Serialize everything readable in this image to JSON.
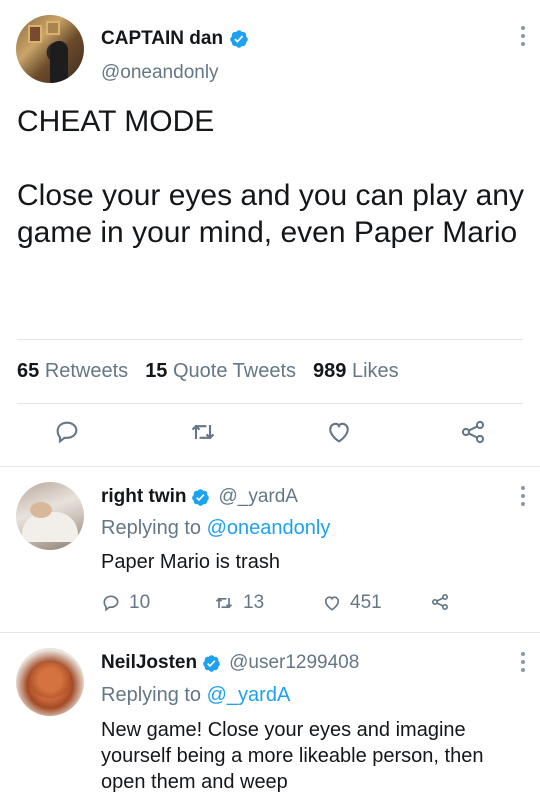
{
  "tweet": {
    "display_name": "CAPTAIN dan",
    "handle": "@oneandonly",
    "verified": true,
    "text": "CHEAT MODE\n\nClose your eyes and you can play any game in your mind, even Paper Mario",
    "stats": {
      "retweets_count": "65",
      "retweets_label": "Retweets",
      "quotes_count": "15",
      "quotes_label": "Quote Tweets",
      "likes_count": "989",
      "likes_label": "Likes"
    },
    "actions": [
      "reply-icon",
      "retweet-icon",
      "like-icon",
      "share-icon"
    ]
  },
  "replies": [
    {
      "display_name": "right twin",
      "handle": "@_yardA",
      "verified": true,
      "replying_prefix": "Replying to",
      "replying_to": "@oneandonly",
      "text": "Paper Mario is trash",
      "replies": "10",
      "retweets": "13",
      "likes": "451"
    },
    {
      "display_name": "NeilJosten",
      "handle": "@user1299408",
      "verified": true,
      "replying_prefix": "Replying to",
      "replying_to": "@_yardA",
      "text": "New game! Close your eyes and imagine yourself being a more likeable person, then open them and weep"
    }
  ],
  "colors": {
    "accent": "#1da1f2",
    "secondary_text": "#657786",
    "divider": "#e1e8ed"
  }
}
